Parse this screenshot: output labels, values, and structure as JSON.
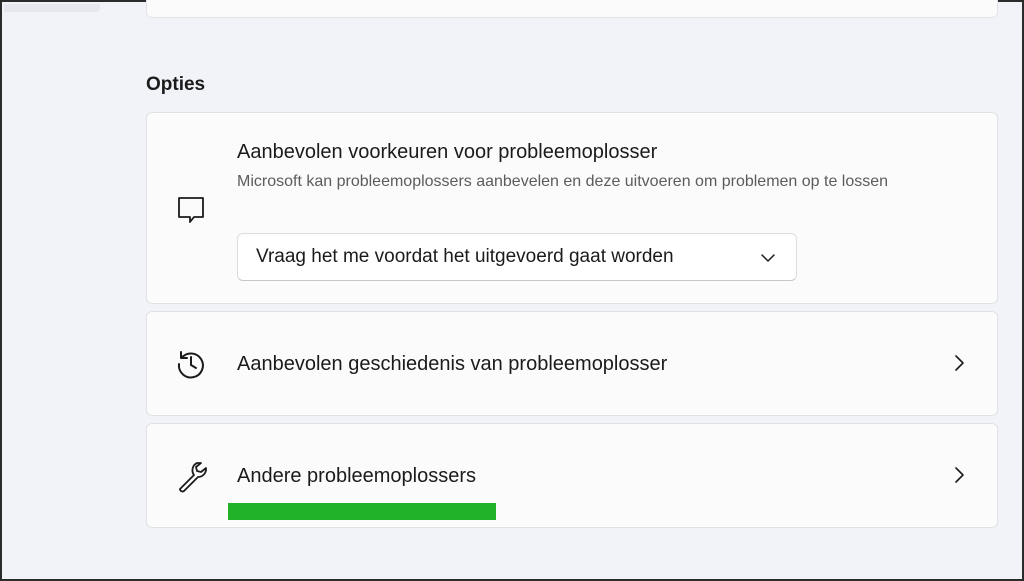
{
  "section": {
    "title": "Opties"
  },
  "recommended_preferences": {
    "title": "Aanbevolen voorkeuren voor probleemoplosser",
    "description": "Microsoft kan probleemoplossers aanbevelen en deze uitvoeren om problemen op te lossen",
    "dropdown_value": "Vraag het me voordat het uitgevoerd gaat worden",
    "icon": "message-icon"
  },
  "recommended_history": {
    "label": "Aanbevolen geschiedenis van probleemoplosser",
    "icon": "history-icon"
  },
  "other_troubleshooters": {
    "label": "Andere probleemoplossers",
    "icon": "wrench-icon"
  },
  "colors": {
    "highlight": "#22b22a",
    "card_background": "#fbfbfc",
    "page_background": "#f1f3f8"
  }
}
